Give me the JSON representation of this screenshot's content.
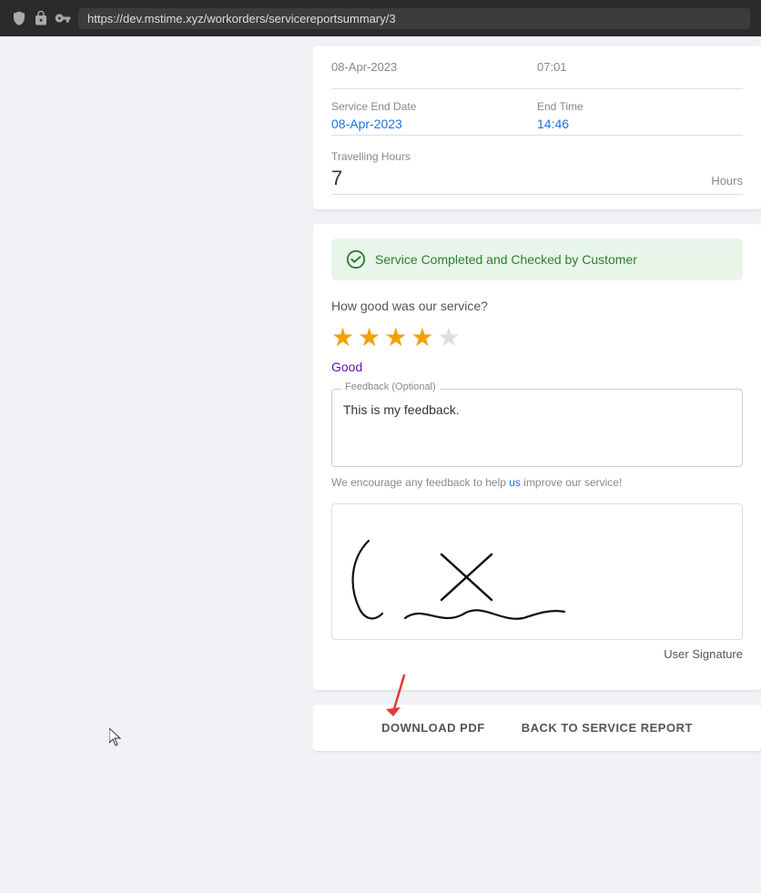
{
  "browser": {
    "url": "https://dev.mstime.xyz/workorders/servicereportsummary/3"
  },
  "top_section": {
    "prev_date_label": "08-Apr-2023",
    "prev_time_label": "07:01",
    "service_end_date_label": "Service End Date",
    "service_end_date_value": "08-Apr-2023",
    "end_time_label": "End Time",
    "end_time_value": "14:46",
    "extra_col_top": "0",
    "extra_col_bottom": "1",
    "travelling_hours_label": "Travelling Hours",
    "travelling_hours_value": "7",
    "hours_unit": "Hours",
    "trav_right": "8"
  },
  "service_section": {
    "completed_banner_text": "Service Completed and Checked by Customer",
    "rating_question": "How good was our service?",
    "stars_filled": 4,
    "stars_total": 5,
    "rating_label": "Good",
    "feedback_field_label": "Feedback (Optional)",
    "feedback_text": "This is my feedback.",
    "feedback_note_before": "We encourage any feedback to help ",
    "feedback_note_link": "us",
    "feedback_note_after": " improve our service!",
    "signature_label": "User Signature",
    "arrow_label": ""
  },
  "actions": {
    "download_label": "DOWNLOAD PDF",
    "back_label": "BACK TO SERVICE REPORT"
  }
}
